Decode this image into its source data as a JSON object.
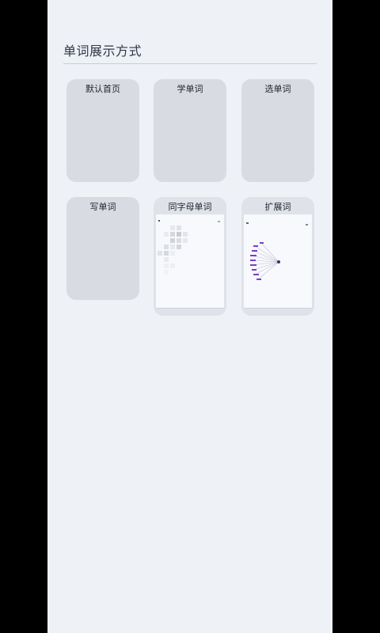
{
  "page": {
    "title": "单词展示方式"
  },
  "cards": [
    {
      "label": "默认首页"
    },
    {
      "label": "学单词"
    },
    {
      "label": "选单词"
    },
    {
      "label": "写单词"
    },
    {
      "label": "同字母单词"
    },
    {
      "label": "扩展词"
    }
  ],
  "colors": {
    "screen_bg": "#eef1f6",
    "card_bg": "#d8dbe2",
    "title_text": "#2f3646",
    "accent_purple": "#7a3fc1"
  }
}
